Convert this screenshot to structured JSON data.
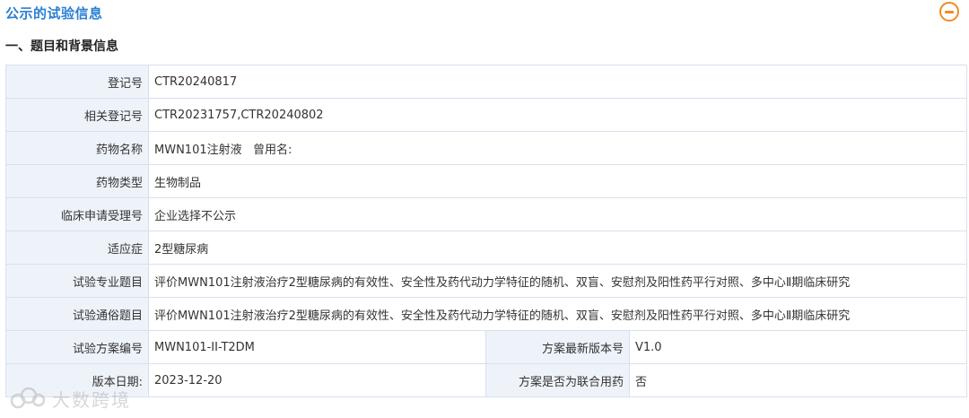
{
  "section_title": "公示的试验信息",
  "subsection_title": "一、题目和背景信息",
  "rows": [
    {
      "label": "登记号",
      "value": "CTR20240817"
    },
    {
      "label": "相关登记号",
      "value": "CTR20231757,CTR20240802"
    },
    {
      "label": "药物名称",
      "value": "MWN101注射液   曾用名:"
    },
    {
      "label": "药物类型",
      "value": "生物制品"
    },
    {
      "label": "临床申请受理号",
      "value": "企业选择不公示"
    },
    {
      "label": "适应症",
      "value": "2型糖尿病"
    },
    {
      "label": "试验专业题目",
      "value": "评价MWN101注射液治疗2型糖尿病的有效性、安全性及药代动力学特征的随机、双盲、安慰剂及阳性药平行对照、多中心Ⅱ期临床研究"
    },
    {
      "label": "试验通俗题目",
      "value": "评价MWN101注射液治疗2型糖尿病的有效性、安全性及药代动力学特征的随机、双盲、安慰剂及阳性药平行对照、多中心Ⅱ期临床研究"
    }
  ],
  "split_rows": [
    {
      "label1": "试验方案编号",
      "value1": "MWN101-II-T2DM",
      "label2": "方案最新版本号",
      "value2": "V1.0"
    },
    {
      "label1": "版本日期:",
      "value1": "2023-12-20",
      "label2": "方案是否为联合用药",
      "value2": "否"
    }
  ],
  "watermark_text": "大数跨境",
  "icons": {
    "collapse": "minus-circle-icon",
    "watermark_logo": "cloud-logo-icon"
  },
  "colors": {
    "accent_blue": "#2a7fd4",
    "collapse_orange": "#f08a24",
    "label_bg": "#eef3fa",
    "border": "#d6e1ef"
  }
}
